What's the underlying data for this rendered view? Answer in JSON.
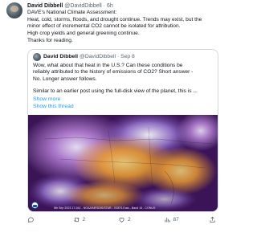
{
  "tweet": {
    "author_name": "David Dibbell",
    "author_handle": "@DavidDibbell",
    "separator": "·",
    "time": "6h",
    "lines": [
      "DAVE's National Climate Assessment:",
      "Heat, cold, storms, floods, and drought continue. Trends may exist, but the",
      "minor effect of incremental CO2 cannot be isolated for attribution.",
      "High crop yields and general greening continue.",
      "Thanks for reading."
    ]
  },
  "quote": {
    "author_name": "David Dibbell",
    "author_handle": "@DavidDibbell",
    "separator": "·",
    "time": "Sep 8",
    "lines": [
      "Wow, what about that heat in the U.S.?  Can these conditions be",
      "reliably attributed to the history of emissions of CO2?  Short answer -",
      "No.  Longer answer follows."
    ],
    "lines2": [
      "Similar to an earlier post using the full-disk view of the planet, this is ..."
    ],
    "show_more": "Show more",
    "show_thread": "Show this thread",
    "image_caption": "5th Sep 2023 17:26Z - NOAA/NESDIS/STAR - GOES-East - Band 16 - CONUS"
  },
  "actions": {
    "replies": "",
    "retweets": "2",
    "likes": "2",
    "views": "87"
  },
  "colors": {
    "link": "#1d9bf0",
    "muted": "#536471",
    "border": "#cfd9de"
  }
}
